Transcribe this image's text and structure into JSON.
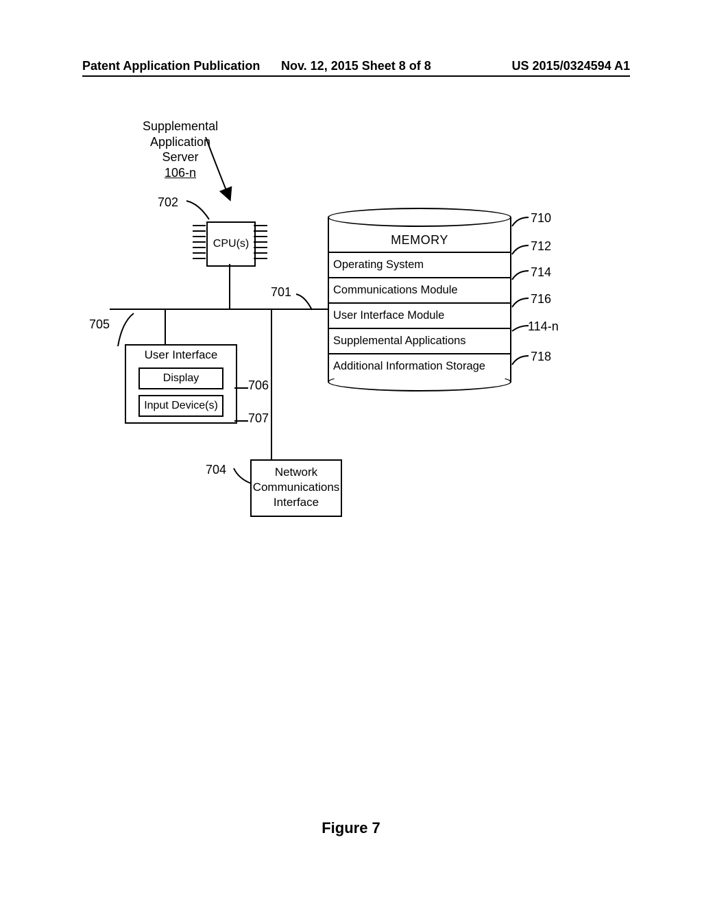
{
  "header": {
    "left": "Patent Application Publication",
    "center": "Nov. 12, 2015  Sheet 8 of 8",
    "right": "US 2015/0324594 A1"
  },
  "figure_title": "Figure 7",
  "title_block": {
    "line1": "Supplemental",
    "line2": "Application",
    "line3": "Server",
    "ref": "106-n"
  },
  "refs": {
    "r701": "701",
    "r702": "702",
    "r704": "704",
    "r705": "705",
    "r706": "706",
    "r707": "707",
    "r710": "710",
    "r712": "712",
    "r714": "714",
    "r716": "716",
    "r114n": "114-n",
    "r718": "718"
  },
  "cpu_label": "CPU(s)",
  "ui": {
    "title": "User Interface",
    "display": "Display",
    "input": "Input Device(s)"
  },
  "network_box": {
    "l1": "Network",
    "l2": "Communications",
    "l3": "Interface"
  },
  "memory": {
    "title": "MEMORY",
    "rows": [
      "Operating System",
      "Communications Module",
      "User Interface Module",
      "Supplemental Applications",
      "Additional Information Storage"
    ]
  }
}
